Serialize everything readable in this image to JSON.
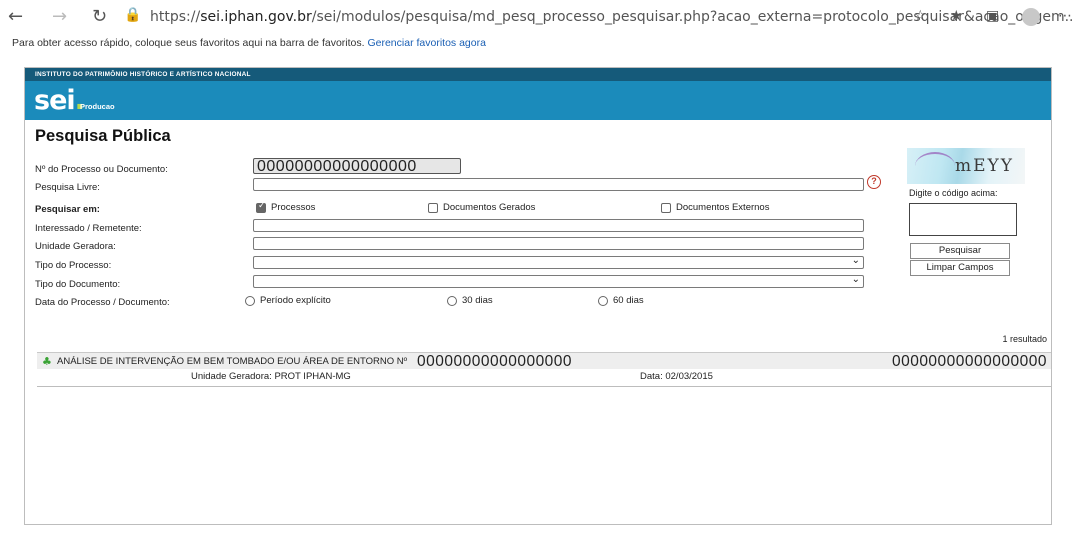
{
  "browser": {
    "url_prefix": "https://",
    "url_domain": "sei.iphan.gov.br",
    "url_path": "/sei/modulos/pesquisa/md_pesq_processo_pesquisar.php?acao_externa=protocolo_pesquisar&acao_origem...",
    "favorites_text": "Para obter acesso rápido, coloque seus favoritos aqui na barra de favoritos.",
    "favorites_link": "Gerenciar favoritos agora"
  },
  "header": {
    "institution": "INSTITUTO DO PATRIMÔNIO HISTÓRICO E ARTÍSTICO NACIONAL",
    "logo": "sei",
    "logo_dot": ".",
    "environment": "Producao",
    "banner_color": "#1b8bbb"
  },
  "page_title": "Pesquisa Pública",
  "form": {
    "process_label": "Nº do Processo ou Documento:",
    "process_value": "00000000000000000",
    "free_search_label": "Pesquisa Livre:",
    "search_in_label": "Pesquisar em:",
    "opt_processos": "Processos",
    "opt_documentos_gerados": "Documentos Gerados",
    "opt_documentos_externos": "Documentos Externos",
    "interessado_label": "Interessado / Remetente:",
    "unidade_label": "Unidade Geradora:",
    "tipo_processo_label": "Tipo do Processo:",
    "tipo_documento_label": "Tipo do Documento:",
    "data_label": "Data do Processo / Documento:",
    "periodo_explicito": "Período explícito",
    "dias_30": "30 dias",
    "dias_60": "60 dias"
  },
  "captcha": {
    "text": "mEYY",
    "label": "Digite o código acima:"
  },
  "buttons": {
    "pesquisar": "Pesquisar",
    "limpar": "Limpar Campos"
  },
  "results": {
    "count": "1 resultado",
    "items": [
      {
        "title": "ANÁLISE DE INTERVENÇÃO EM BEM TOMBADO E/OU ÁREA DE ENTORNO Nº",
        "number": "00000000000000000",
        "number_right": "00000000000000000",
        "unit_label": "Unidade Geradora:",
        "unit_value": "PROT IPHAN-MG",
        "date_label": "Data:",
        "date_value": "02/03/2015"
      }
    ]
  }
}
